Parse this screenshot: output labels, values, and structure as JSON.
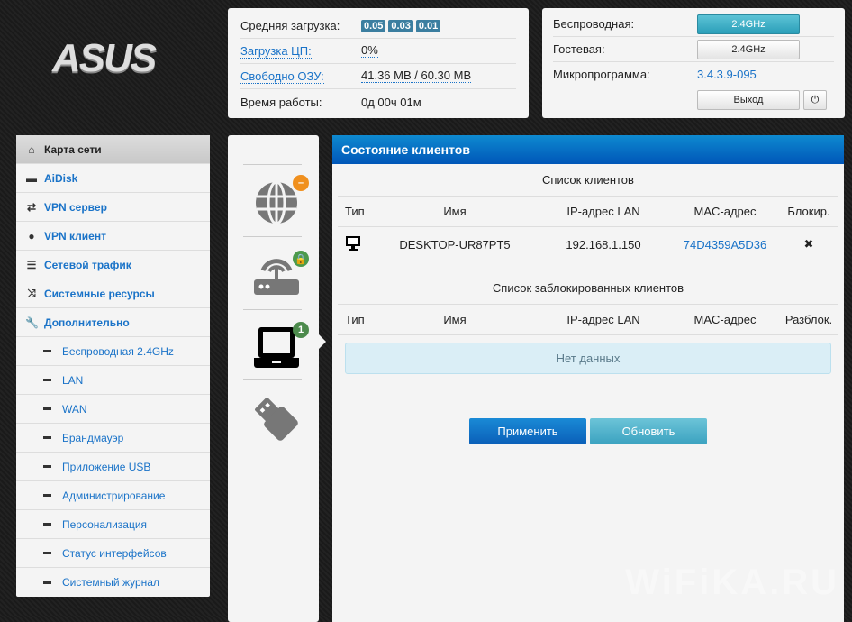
{
  "logo": "ASUS",
  "status": {
    "avg_load_label": "Средняя загрузка:",
    "avg_load": [
      "0.05",
      "0.03",
      "0.01"
    ],
    "cpu_label": "Загрузка ЦП:",
    "cpu": "0%",
    "ram_label": "Свободно ОЗУ:",
    "ram": "41.36 MB / 60.30 MB",
    "uptime_label": "Время работы:",
    "uptime": "0д 00ч 01м"
  },
  "firmware": {
    "wireless_label": "Беспроводная:",
    "wireless_btn": "2.4GHz",
    "guest_label": "Гостевая:",
    "guest_btn": "2.4GHz",
    "fw_label": "Микропрограмма:",
    "fw_version": "3.4.3.9-095",
    "logout": "Выход"
  },
  "sidebar": {
    "items": [
      {
        "label": "Карта сети"
      },
      {
        "label": "AiDisk"
      },
      {
        "label": "VPN сервер"
      },
      {
        "label": "VPN клиент"
      },
      {
        "label": "Сетевой трафик"
      },
      {
        "label": "Системные ресурсы"
      },
      {
        "label": "Дополнительно"
      }
    ],
    "sub": [
      {
        "label": "Беспроводная 2.4GHz"
      },
      {
        "label": "LAN"
      },
      {
        "label": "WAN"
      },
      {
        "label": "Брандмауэр"
      },
      {
        "label": "Приложение USB"
      },
      {
        "label": "Администрирование"
      },
      {
        "label": "Персонализация"
      },
      {
        "label": "Статус интерфейсов"
      },
      {
        "label": "Системный журнал"
      }
    ]
  },
  "icons": {
    "clients_count": "1"
  },
  "main": {
    "title": "Состояние клиентов",
    "clients_title": "Список клиентов",
    "cols": [
      "Тип",
      "Имя",
      "IP-адрес LAN",
      "MAC-адрес",
      "Блокир."
    ],
    "clients": [
      {
        "name": "DESKTOP-UR87PT5",
        "ip": "192.168.1.150",
        "mac": "74D4359A5D36",
        "block": "✖"
      }
    ],
    "blocked_title": "Список заблокированных клиентов",
    "blocked_cols": [
      "Тип",
      "Имя",
      "IP-адрес LAN",
      "MAC-адрес",
      "Разблок."
    ],
    "no_data": "Нет данных",
    "apply": "Применить",
    "refresh": "Обновить"
  },
  "watermark": "WiFiKA.RU"
}
